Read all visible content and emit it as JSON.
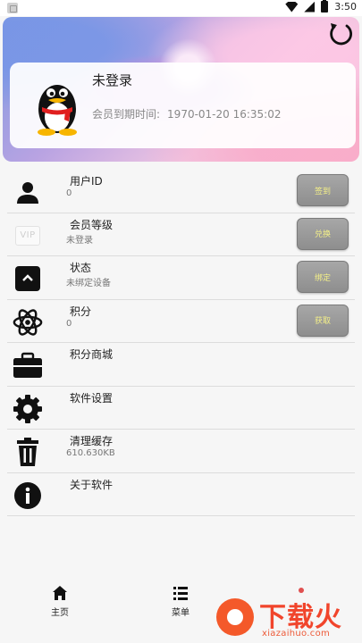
{
  "status_bar": {
    "time": "3:50"
  },
  "profile": {
    "login_status": "未登录",
    "vip_expiry_label": "会员到期时间:",
    "vip_expiry_value": "1970-01-20 16:35:02"
  },
  "list": {
    "items": [
      {
        "title": "用户ID",
        "subtitle": "0",
        "icon": "user-icon",
        "button": "签到"
      },
      {
        "title": "会员等级",
        "subtitle": "未登录",
        "icon": "vip-icon",
        "icon_text": "VIP",
        "button": "兑换"
      },
      {
        "title": "状态",
        "subtitle": "未绑定设备",
        "icon": "status-icon",
        "button": "绑定"
      },
      {
        "title": "积分",
        "subtitle": "0",
        "icon": "atom-icon",
        "button": "获取"
      },
      {
        "title": "积分商城",
        "icon": "briefcase-icon"
      },
      {
        "title": "软件设置",
        "icon": "gear-icon"
      },
      {
        "title": "清理缓存",
        "subtitle": "610.630KB",
        "icon": "trash-icon"
      },
      {
        "title": "关于软件",
        "icon": "info-icon"
      }
    ]
  },
  "bottom_nav": {
    "home": "主页",
    "menu": "菜单"
  },
  "watermark": {
    "title": "下载火",
    "url": "xiazaihuo.com"
  },
  "colors": {
    "button_bg": "#999999",
    "button_text": "#f3ef88",
    "watermark": "#f1452c"
  }
}
